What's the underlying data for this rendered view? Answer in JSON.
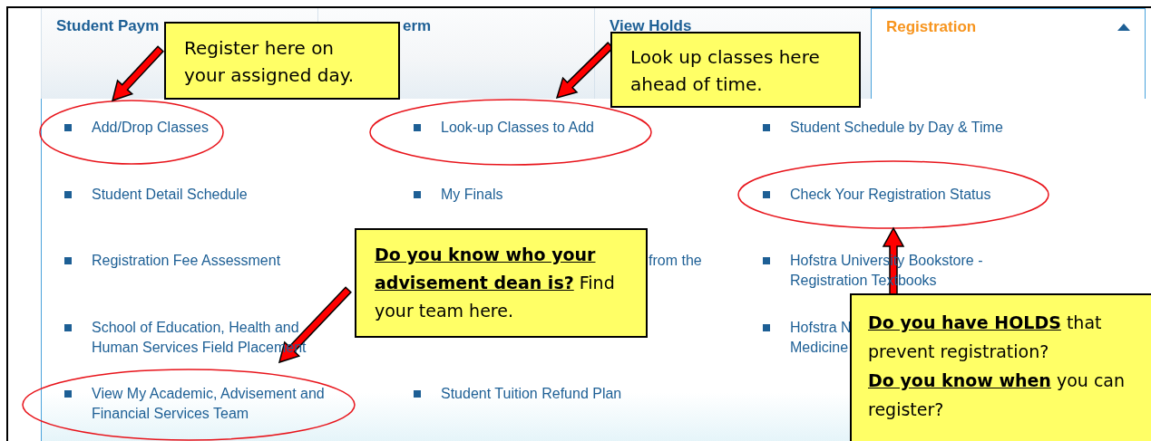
{
  "tabs": [
    {
      "label": "Student Paym",
      "selected": false
    },
    {
      "label": "erm",
      "selected": false,
      "kind": "partial"
    },
    {
      "label": "View Holds",
      "selected": false
    },
    {
      "label": "Registration",
      "selected": true
    }
  ],
  "menu_rows": [
    {
      "column_1": {
        "text": "Add/Drop Classes"
      },
      "column_2": {
        "text": "Look-up Classes to Add"
      },
      "column_3": {
        "text": "Student Schedule by Day & Time"
      }
    },
    {
      "column_1": {
        "text": "Student Detail Schedule"
      },
      "column_2": {
        "text": "My Finals"
      },
      "column_3": {
        "text": "Check Your Registration Status"
      }
    },
    {
      "column_1": {
        "text": "Registration Fee Assessment"
      },
      "column_2": {
        "text": "from the",
        "kind": "partial"
      },
      "column_3": {
        "text": "Hofstra University Bookstore -\nRegistration Textbooks"
      }
    },
    {
      "column_1": {
        "text": "School of Education, Health and\nHuman Services Field Placement"
      },
      "column_3": {
        "text": "Hofstra N\nMedicine"
      }
    },
    {
      "column_1": {
        "text": "View My Academic, Advisement and\nFinancial Services Team"
      },
      "column_2": {
        "text": "Student Tuition Refund Plan"
      }
    }
  ],
  "callouts": [
    {
      "paragraphs": [
        "Register here on your assigned day."
      ]
    },
    {
      "paragraphs": [
        "Look up classes here ahead of time."
      ]
    },
    {
      "paragraphs": [
        "**Do you know who your advisement dean is?** Find your team here."
      ]
    },
    {
      "paragraphs": [
        "**Do you have HOLDS** that prevent registration?",
        "**Do you know when** you can register?"
      ]
    }
  ]
}
